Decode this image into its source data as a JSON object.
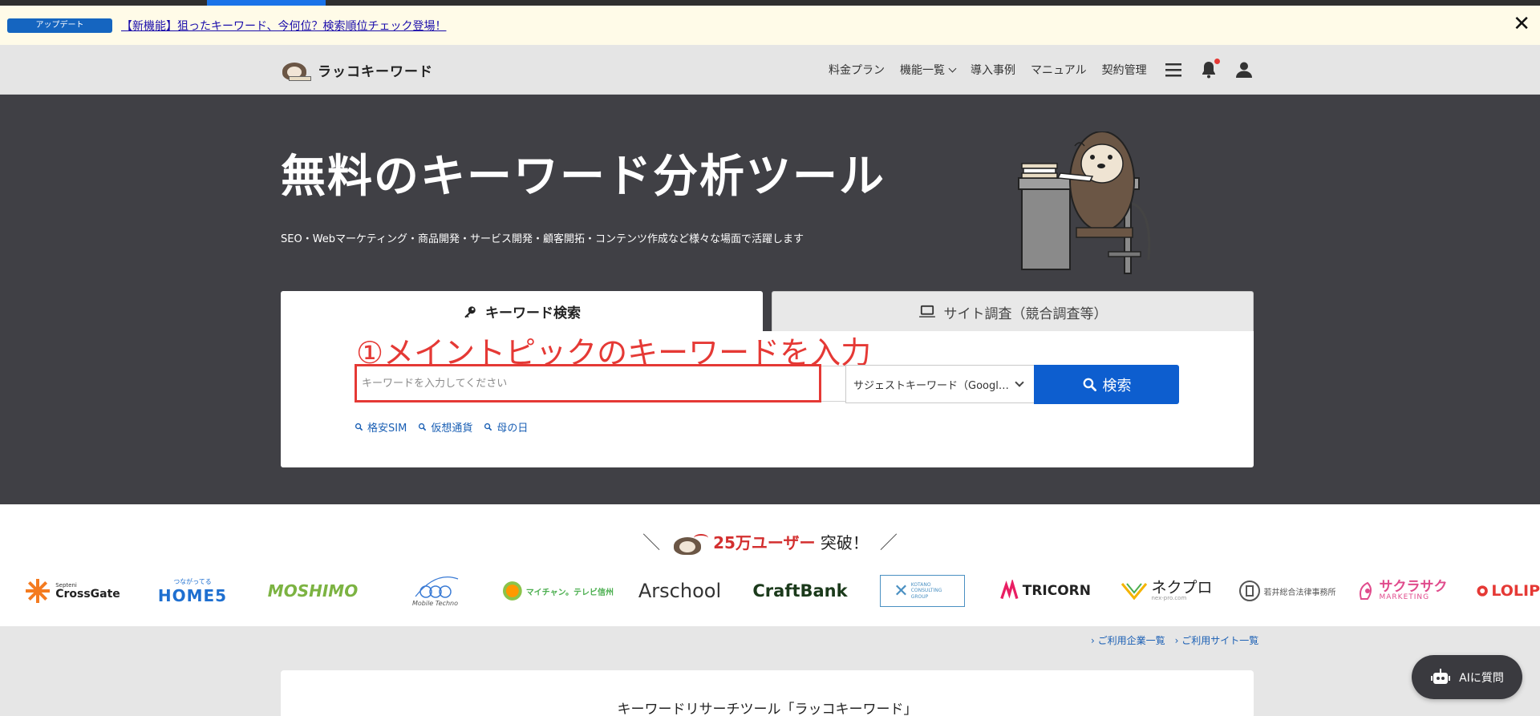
{
  "announcement": {
    "badge": "アップデート",
    "link": "【新機能】狙ったキーワード、今何位？検索順位チェック登場！",
    "close_icon": "close-icon"
  },
  "header": {
    "logo_text": "ラッコキーワード",
    "nav": [
      {
        "label": "料金プラン"
      },
      {
        "label": "機能一覧",
        "has_dropdown": true
      },
      {
        "label": "導入事例"
      },
      {
        "label": "マニュアル"
      },
      {
        "label": "契約管理"
      }
    ],
    "icons": [
      "hamburger-menu-icon",
      "bell-icon",
      "user-icon"
    ]
  },
  "hero": {
    "title": "無料のキーワード分析ツール",
    "subtitle": "SEO・Webマーケティング・商品開発・サービス開発・顧客開拓・コンテンツ作成など様々な場面で活躍します",
    "tabs": [
      {
        "label": "キーワード検索",
        "active": true,
        "icon": "key-icon"
      },
      {
        "label": "サイト調査（競合調査等）",
        "active": false,
        "icon": "laptop-icon"
      }
    ],
    "annotation": "①メイントピックのキーワードを入力",
    "search_placeholder": "キーワードを入力してください",
    "select_value": "サジェストキーワード（Googl…",
    "search_button": "検索",
    "suggestions": [
      "格安SIM",
      "仮想通貨",
      "母の日"
    ]
  },
  "users": {
    "count": "25万ユーザー",
    "suffix": "突破！",
    "logos": [
      {
        "text": "CrossGate",
        "top": "Septeni",
        "color": "#222"
      },
      {
        "text": "HOME5",
        "top": "つながってる",
        "color": "#1e6fd0"
      },
      {
        "text": "MOSHIMO",
        "top": "",
        "color": "#7cb342"
      },
      {
        "text": "Mobile Techno",
        "top": "",
        "color": "#555"
      },
      {
        "text": "マイチャン。テレビ信州",
        "top": "",
        "color": "#4caf50"
      },
      {
        "text": "Arschool",
        "top": "",
        "color": "#333"
      },
      {
        "text": "CraftBank",
        "top": "",
        "color": "#1b3a1b"
      },
      {
        "text": "KOTANO CONSULTING GROUP",
        "top": "",
        "color": "#4a90c2"
      },
      {
        "text": "TRICORN",
        "top": "",
        "color": "#222"
      },
      {
        "text": "ネクプロ",
        "top": "nex-pro.com",
        "color": "#222"
      },
      {
        "text": "若井総合法律事務所",
        "top": "",
        "color": "#555"
      },
      {
        "text": "サクラサク",
        "top": "MARKETING",
        "color": "#e04b8c"
      },
      {
        "text": "LOLIP",
        "top": "",
        "color": "#e53935"
      }
    ]
  },
  "links": [
    "ご利用企業一覧",
    "ご利用サイト一覧"
  ],
  "bottom_card": {
    "title": "キーワードリサーチツール「ラッコキーワード」"
  },
  "ai_button": "AIに質問",
  "colors": {
    "accent": "#0d5ecf",
    "annotation": "#e53935",
    "hero_bg": "#404045"
  }
}
